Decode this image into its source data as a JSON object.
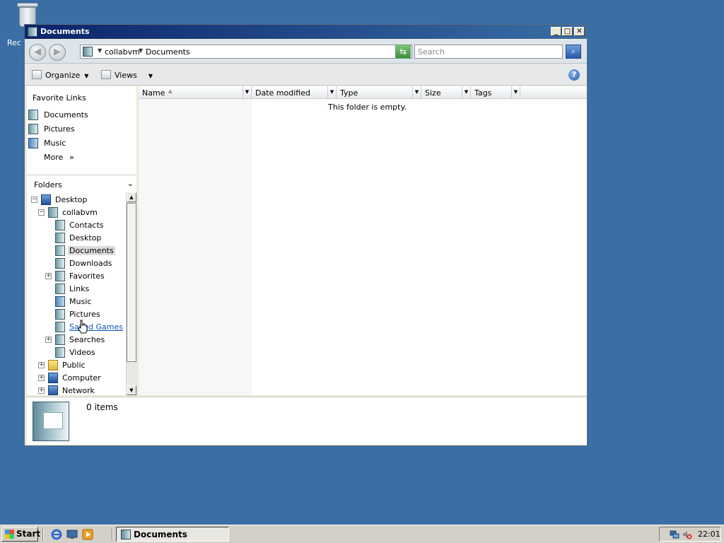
{
  "desktop": {
    "recycle_label": "Rec"
  },
  "window": {
    "title": "Documents",
    "controls": {
      "minimize": "_",
      "maximize": "□",
      "close": "✕"
    }
  },
  "address": {
    "crumbs": [
      "collabvm",
      "Documents"
    ],
    "search_placeholder": "Search"
  },
  "toolbar": {
    "organize": "Organize",
    "views": "Views",
    "help": "?"
  },
  "favorites": {
    "title": "Favorite Links",
    "items": [
      "Documents",
      "Pictures",
      "Music"
    ],
    "more": "More",
    "more_glyph": "»"
  },
  "folders": {
    "title": "Folders",
    "tree": [
      {
        "label": "Desktop",
        "level": 0,
        "expander": "−",
        "icon": "desktop-icon"
      },
      {
        "label": "collabvm",
        "level": 1,
        "expander": "−",
        "icon": "user-folder-icon"
      },
      {
        "label": "Contacts",
        "level": 2,
        "expander": "",
        "icon": "contacts-folder-icon"
      },
      {
        "label": "Desktop",
        "level": 2,
        "expander": "",
        "icon": "folder-icon"
      },
      {
        "label": "Documents",
        "level": 2,
        "expander": "",
        "icon": "documents-folder-icon",
        "selected": true
      },
      {
        "label": "Downloads",
        "level": 2,
        "expander": "",
        "icon": "downloads-folder-icon"
      },
      {
        "label": "Favorites",
        "level": 2,
        "expander": "+",
        "icon": "favorites-folder-icon"
      },
      {
        "label": "Links",
        "level": 2,
        "expander": "",
        "icon": "links-folder-icon"
      },
      {
        "label": "Music",
        "level": 2,
        "expander": "",
        "icon": "music-folder-icon"
      },
      {
        "label": "Pictures",
        "level": 2,
        "expander": "",
        "icon": "pictures-folder-icon"
      },
      {
        "label": "Saved Games",
        "level": 2,
        "expander": "",
        "icon": "saved-games-folder-icon",
        "hover": true
      },
      {
        "label": "Searches",
        "level": 2,
        "expander": "+",
        "icon": "searches-folder-icon"
      },
      {
        "label": "Videos",
        "level": 2,
        "expander": "",
        "icon": "videos-folder-icon"
      },
      {
        "label": "Public",
        "level": 1,
        "expander": "+",
        "icon": "public-folder-icon"
      },
      {
        "label": "Computer",
        "level": 1,
        "expander": "+",
        "icon": "computer-icon"
      },
      {
        "label": "Network",
        "level": 1,
        "expander": "+",
        "icon": "network-icon"
      }
    ]
  },
  "columns": [
    "Name",
    "Date modified",
    "Type",
    "Size",
    "Tags"
  ],
  "content": {
    "empty_text": "This folder is empty."
  },
  "details": {
    "count": "0 items"
  },
  "taskbar": {
    "start": "Start",
    "task_label": "Documents",
    "clock": "22:01"
  }
}
